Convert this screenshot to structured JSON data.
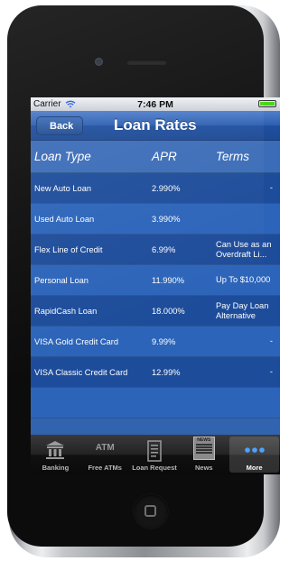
{
  "status": {
    "carrier": "Carrier",
    "time": "7:46 PM"
  },
  "nav": {
    "back": "Back",
    "title": "Loan Rates"
  },
  "columns": {
    "type": "Loan Type",
    "apr": "APR",
    "terms": "Terms"
  },
  "rows": [
    {
      "type": "New Auto Loan",
      "apr": "2.990%",
      "terms": "-"
    },
    {
      "type": "Used Auto Loan",
      "apr": "3.990%",
      "terms": ""
    },
    {
      "type": "Flex Line of Credit",
      "apr": "6.99%",
      "terms": "Can Use as an Overdraft Li..."
    },
    {
      "type": "Personal Loan",
      "apr": "11.990%",
      "terms": "Up To $10,000"
    },
    {
      "type": "RapidCash Loan",
      "apr": "18.000%",
      "terms": "Pay Day Loan Alternative"
    },
    {
      "type": "VISA Gold Credit Card",
      "apr": "9.99%",
      "terms": "-"
    },
    {
      "type": "VISA Classic Credit Card",
      "apr": "12.99%",
      "terms": "-"
    }
  ],
  "tabs": [
    {
      "label": "Banking",
      "icon": "bank-icon"
    },
    {
      "label": "Free ATMs",
      "icon": "atm-icon",
      "icon_text": "ATM"
    },
    {
      "label": "Loan Request",
      "icon": "document-icon"
    },
    {
      "label": "News",
      "icon": "newspaper-icon",
      "icon_text": "NEWS"
    },
    {
      "label": "More",
      "icon": "more-icon",
      "active": true
    }
  ],
  "colors": {
    "nav": "#2c5fb0",
    "row_dark": "#1d4c9a",
    "row_light": "#2c64b9",
    "header": "#3b6cb8",
    "battery": "#4cd41c"
  }
}
